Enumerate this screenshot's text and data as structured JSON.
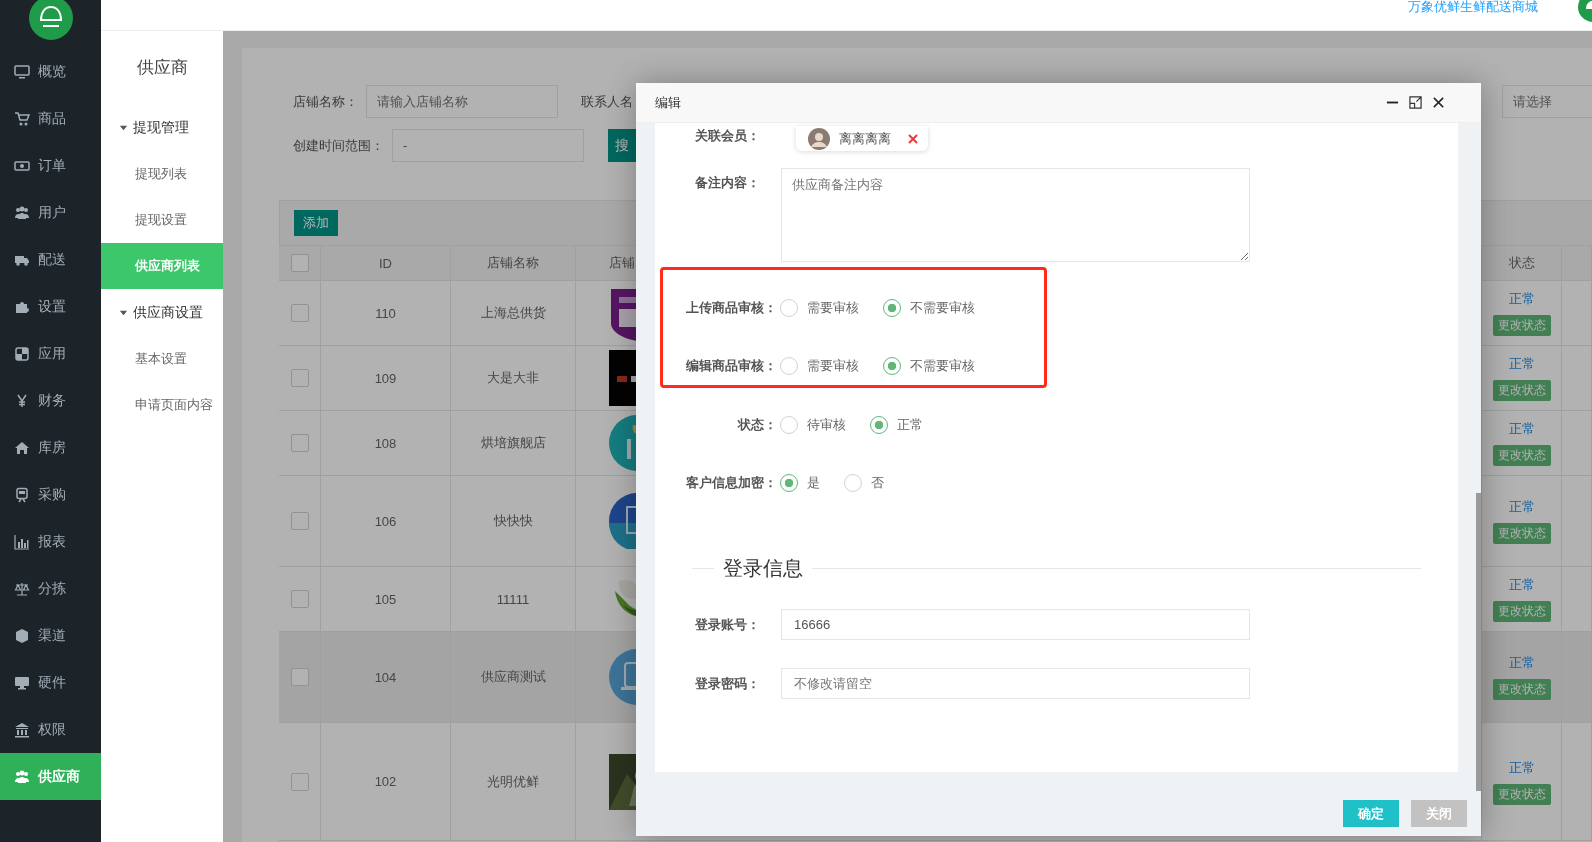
{
  "top_bar": {
    "site_link": "万象优鲜生鲜配送商城"
  },
  "sidebar": {
    "items": [
      {
        "label": "概览",
        "selected": false
      },
      {
        "label": "商品",
        "selected": false
      },
      {
        "label": "订单",
        "selected": false
      },
      {
        "label": "用户",
        "selected": false
      },
      {
        "label": "配送",
        "selected": false
      },
      {
        "label": "设置",
        "selected": false
      },
      {
        "label": "应用",
        "selected": false
      },
      {
        "label": "财务",
        "selected": false
      },
      {
        "label": "库房",
        "selected": false
      },
      {
        "label": "采购",
        "selected": false
      },
      {
        "label": "报表",
        "selected": false
      },
      {
        "label": "分拣",
        "selected": false
      },
      {
        "label": "渠道",
        "selected": false
      },
      {
        "label": "硬件",
        "selected": false
      },
      {
        "label": "权限",
        "selected": false
      },
      {
        "label": "供应商",
        "selected": true
      }
    ]
  },
  "submenu": {
    "title": "供应商",
    "groups": [
      {
        "label": "提现管理",
        "expanded": true,
        "children": [
          {
            "label": "提现列表",
            "selected": false
          },
          {
            "label": "提现设置",
            "selected": false
          },
          {
            "label": "供应商列表",
            "selected": true
          }
        ]
      },
      {
        "label": "供应商设置",
        "expanded": true,
        "children": [
          {
            "label": "基本设置",
            "selected": false
          },
          {
            "label": "申请页面内容",
            "selected": false
          }
        ]
      }
    ]
  },
  "filters": {
    "shop_name": {
      "label": "店铺名称：",
      "placeholder": "请输入店铺名称"
    },
    "contact_label": "联系人名",
    "right_select": {
      "placeholder": "请选择"
    },
    "date_range": {
      "label": "创建时间范围：",
      "value": "-"
    },
    "search_button": "搜"
  },
  "toolbar": {
    "add_button": "添加"
  },
  "table": {
    "header_checked": false,
    "columns": [
      "ID",
      "店铺名称",
      "店铺",
      "状态"
    ],
    "rows": [
      {
        "checked": false,
        "hovered": false,
        "id": "110",
        "name": "上海总供货",
        "status": "正常",
        "action": "更改状态"
      },
      {
        "checked": false,
        "hovered": false,
        "id": "109",
        "name": "大是大非",
        "status": "正常",
        "action": "更改状态"
      },
      {
        "checked": false,
        "hovered": false,
        "id": "108",
        "name": "烘培旗舰店",
        "status": "正常",
        "action": "更改状态"
      },
      {
        "checked": false,
        "hovered": false,
        "id": "106",
        "name": "快快快",
        "status": "正常",
        "action": "更改状态"
      },
      {
        "checked": false,
        "hovered": false,
        "id": "105",
        "name": "11111",
        "status": "正常",
        "action": "更改状态"
      },
      {
        "checked": false,
        "hovered": true,
        "id": "104",
        "name": "供应商测试",
        "status": "正常",
        "action": "更改状态"
      },
      {
        "checked": false,
        "hovered": false,
        "id": "102",
        "name": "光明优鲜",
        "status": "正常",
        "action": "更改状态"
      }
    ]
  },
  "modal": {
    "title": "编辑",
    "member": {
      "label": "关联会员：",
      "name": "离离离离"
    },
    "remark": {
      "label": "备注内容：",
      "placeholder": "供应商备注内容"
    },
    "radio_groups": [
      {
        "label": "上传商品审核：",
        "highlighted": true,
        "options": [
          {
            "label": "需要审核",
            "selected": false
          },
          {
            "label": "不需要审核",
            "selected": true
          }
        ]
      },
      {
        "label": "编辑商品审核：",
        "highlighted": true,
        "options": [
          {
            "label": "需要审核",
            "selected": false
          },
          {
            "label": "不需要审核",
            "selected": true
          }
        ]
      },
      {
        "label": "状态：",
        "highlighted": false,
        "options": [
          {
            "label": "待审核",
            "selected": false
          },
          {
            "label": "正常",
            "selected": true
          }
        ]
      },
      {
        "label": "客户信息加密：",
        "highlighted": false,
        "options": [
          {
            "label": "是",
            "selected": true
          },
          {
            "label": "否",
            "selected": false
          }
        ]
      }
    ],
    "section_title": "登录信息",
    "account": {
      "label": "登录账号：",
      "value": "16666"
    },
    "password": {
      "label": "登录密码：",
      "placeholder": "不修改请留空"
    },
    "buttons": [
      {
        "label": "确定",
        "kind": "primary"
      },
      {
        "label": "关闭",
        "kind": "secondary"
      }
    ]
  }
}
